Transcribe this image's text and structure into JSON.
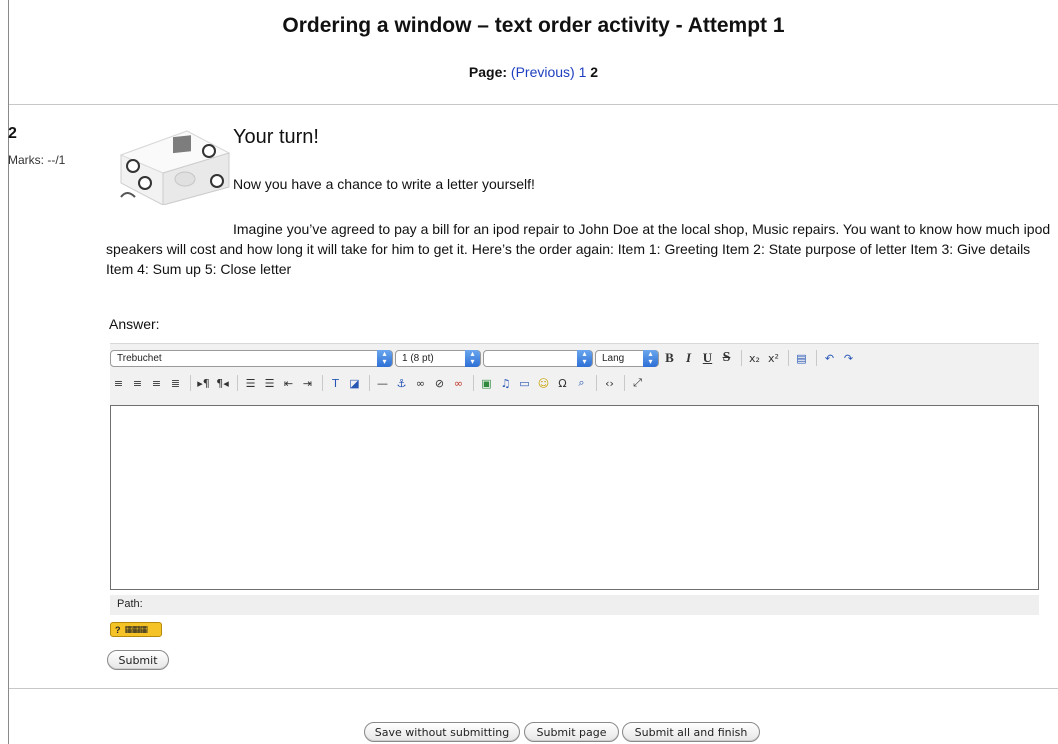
{
  "page": {
    "title": "Ordering a window – text order activity - Attempt 1",
    "pager_label": "Page:",
    "pager_previous": "(Previous)",
    "pager_page1": "1",
    "pager_current": "2"
  },
  "question": {
    "number": "2",
    "marks": "Marks: --/1",
    "heading": "Your turn!",
    "intro": "Now you have a chance to write a letter yourself!",
    "body": "Imagine you’ve agreed to pay a bill for an ipod repair to John Doe at the local shop, Music repairs. You want to know how much ipod speakers will cost and how long it will take for him to get it. Here’s the order again: Item 1: Greeting Item 2: State purpose of letter Item 3: Give details Item 4: Sum up 5: Close letter",
    "answer_label": "Answer:"
  },
  "editor": {
    "font_family": "Trebuchet",
    "font_size": "1 (8 pt)",
    "heading_format": "",
    "lang": "Lang",
    "path_label": "Path:",
    "content": ""
  },
  "buttons": {
    "submit": "Submit",
    "save_without_submitting": "Save without submitting",
    "submit_page": "Submit page",
    "submit_all_finish": "Submit all and finish"
  },
  "icons": {
    "image": "ipod-speaker-image",
    "help": "help-keyboard-icon"
  }
}
